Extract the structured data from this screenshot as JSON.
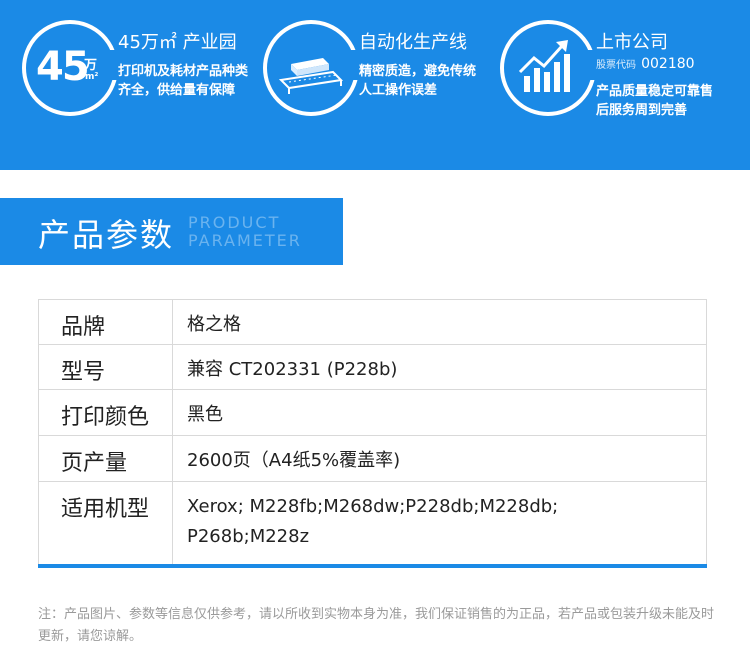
{
  "features": [
    {
      "id": "park",
      "badge_number": "45",
      "badge_unit": "万",
      "badge_sup": "m²",
      "title": "45万㎡ 产业园",
      "desc": "打印机及耗材产品种类齐全，供给量有保障"
    },
    {
      "id": "line",
      "icon": "conveyor-icon",
      "title": "自动化生产线",
      "desc": "精密质造，避免传统人工操作误差"
    },
    {
      "id": "listed",
      "icon": "growth-chart-icon",
      "title": "上市公司",
      "stock_prefix": "股票代码",
      "stock_code": "002180",
      "desc": "产品质量稳定可靠售后服务周到完善"
    }
  ],
  "section": {
    "title": "产品参数",
    "en_line1": "PRODUCT",
    "en_line2": "PARAMETER"
  },
  "params": [
    {
      "label": "品牌",
      "value": "格之格"
    },
    {
      "label": "型号",
      "value": "兼容 CT202331 (P228b)"
    },
    {
      "label": "打印颜色",
      "value": "黑色"
    },
    {
      "label": "页产量",
      "value": "2600页（A4纸5%覆盖率)"
    },
    {
      "label": "适用机型",
      "value": "Xerox; M228fb;M268dw;P228db;M228db; P268b;M228z"
    }
  ],
  "note": "注：产品图片、参数等信息仅供参考，请以所收到实物本身为准，我们保证销售的为正品，若产品或包装升级未能及时更新，请您谅解。",
  "colors": {
    "brand_blue": "#1b8ae6",
    "table_border": "#d9d9d9",
    "note_gray": "#9a9a9a"
  }
}
